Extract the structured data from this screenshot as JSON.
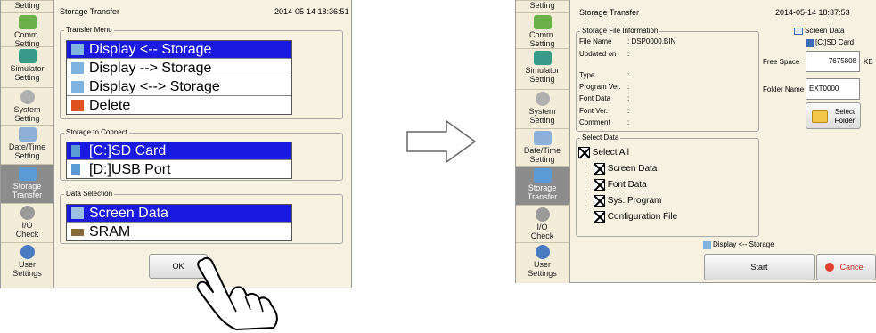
{
  "left": {
    "sidebar": [
      {
        "label": "Setting",
        "icon": "setting-icon"
      },
      {
        "label": "Comm.\nSetting",
        "icon": "comm-icon"
      },
      {
        "label": "Simulator\nSetting",
        "icon": "simulator-icon"
      },
      {
        "label": "System\nSetting",
        "icon": "gear-icon"
      },
      {
        "label": "Date/Time\nSetting",
        "icon": "calendar-icon"
      },
      {
        "label": "Storage\nTransfer",
        "icon": "storage-icon"
      },
      {
        "label": "I/O\nCheck",
        "icon": "io-icon"
      },
      {
        "label": "User\nSettings",
        "icon": "user-icon"
      }
    ],
    "title": "Storage Transfer",
    "datetime": "2014-05-14  18:36:51",
    "transfer_menu": {
      "title": "Transfer Menu",
      "items": [
        "Display <-- Storage",
        "Display --> Storage",
        "Display <--> Storage",
        "Delete"
      ]
    },
    "storage_connect": {
      "title": "Storage to Connect",
      "items": [
        "[C:]SD Card",
        "[D:]USB Port"
      ]
    },
    "data_selection": {
      "title": "Data Selection",
      "items": [
        "Screen Data",
        "SRAM"
      ]
    },
    "ok_label": "OK"
  },
  "right": {
    "sidebar": [
      {
        "label": "Setting",
        "icon": "setting-icon"
      },
      {
        "label": "Comm.\nSetting",
        "icon": "comm-icon"
      },
      {
        "label": "Simulator\nSetting",
        "icon": "simulator-icon"
      },
      {
        "label": "System\nSetting",
        "icon": "gear-icon"
      },
      {
        "label": "Date/Time\nSetting",
        "icon": "calendar-icon"
      },
      {
        "label": "Storage\nTransfer",
        "icon": "storage-icon"
      },
      {
        "label": "I/O\nCheck",
        "icon": "io-icon"
      },
      {
        "label": "User\nSettings",
        "icon": "user-icon"
      }
    ],
    "title": "Storage Transfer",
    "datetime": "2014-05-14  18:37:53",
    "file_info": {
      "title": "Storage File Information",
      "rows": [
        {
          "label": "File Name",
          "value": ": DSP0000.BIN"
        },
        {
          "label": "Updated on",
          "value": ":"
        },
        {
          "label": "Type",
          "value": ":"
        },
        {
          "label": "Program Ver.",
          "value": ":"
        },
        {
          "label": "Font Data",
          "value": ":"
        },
        {
          "label": "Font Ver.",
          "value": ":"
        },
        {
          "label": "Comment",
          "value": ":"
        }
      ]
    },
    "legend_screen": "Screen Data",
    "legend_storage": "[C:]SD Card",
    "free_space_label": "Free Space",
    "free_space_value": "7675808",
    "free_space_unit": "KB",
    "folder_name_label": "Folder Name",
    "folder_name_value": "EXT0000",
    "select_folder_label": "Select\nFolder",
    "select_data": {
      "title": "Select Data",
      "all": "Select All",
      "items": [
        "Screen Data",
        "Font Data",
        "Sys. Program",
        "Configuration File"
      ]
    },
    "direction": "Display <-- Storage",
    "start_label": "Start",
    "cancel_label": "Cancel"
  },
  "colors": {
    "selected": "#1a1ae0",
    "panel": "#f6f1e1",
    "sidebar": "#f2ecd9"
  }
}
